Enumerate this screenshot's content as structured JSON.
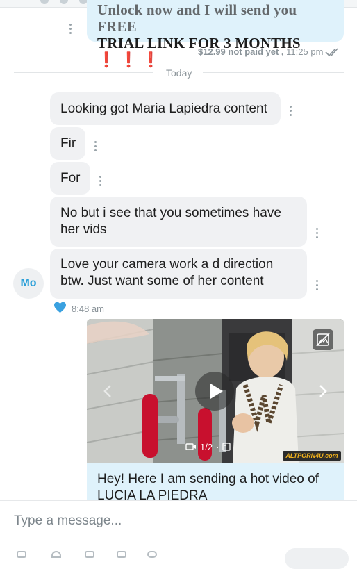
{
  "thread": {
    "prev_message": {
      "line1": "Unlock now and I will send you FREE",
      "line2": "TRIAL LINK FOR 3 MONTHS",
      "marks": "❗❗❗",
      "status": "$12.99 not paid yet ,",
      "time": "11:25 pm"
    },
    "day_divider": "Today",
    "incoming": [
      {
        "text": "Looking got Maria Lapiedra content"
      },
      {
        "text": "Fir"
      },
      {
        "text": "For"
      },
      {
        "line1": "No but i see that you sometimes have",
        "line2": "her vids"
      },
      {
        "line1": "Love your camera work a d direction",
        "line2": "btw. Just want some of her content"
      }
    ],
    "sender_avatar": "Mo",
    "incoming_time": "8:48 am",
    "media_message": {
      "counter": "1/2",
      "watermark": "ALTPORN4U.com",
      "caption_line1": "Hey! Here I am sending a hot video of",
      "caption_line2": "LUCIA LA PIEDRA"
    }
  },
  "composer": {
    "placeholder": "Type a message..."
  },
  "colors": {
    "accent": "#2a9fd8",
    "outgoing_bubble": "#dff2fb",
    "incoming_bubble": "#f0f1f3",
    "heart": "#3aa1e0",
    "exclaim": "#d6241f"
  }
}
